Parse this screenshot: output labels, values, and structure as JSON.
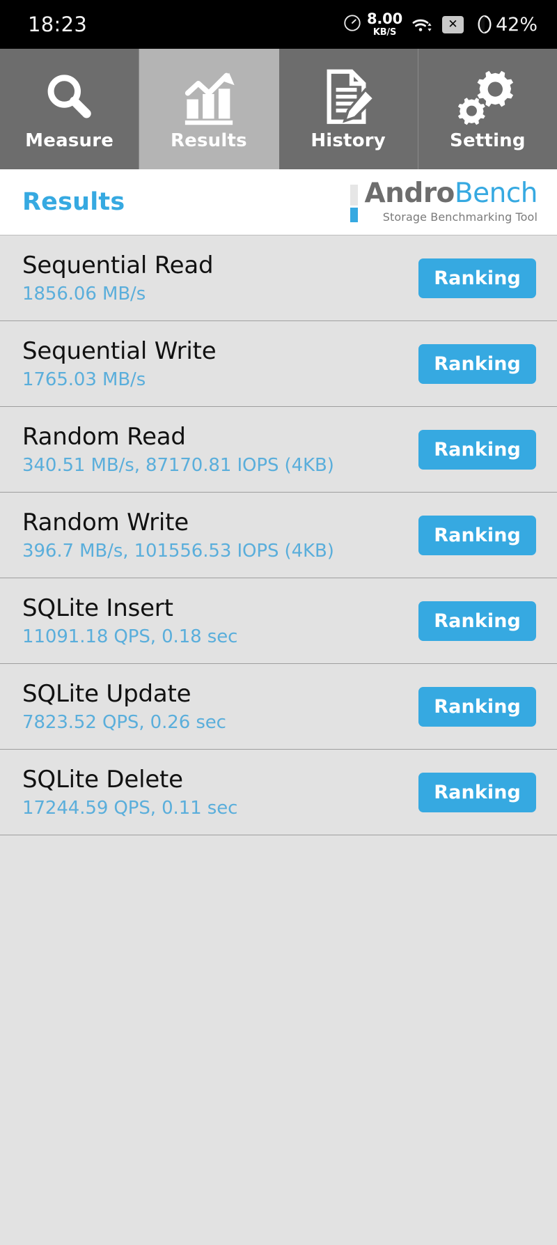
{
  "status_bar": {
    "time": "18:23",
    "network_speed_value": "8.00",
    "network_speed_unit": "KB/S",
    "battery_percent": "42%",
    "icons": [
      "speedometer-icon",
      "wifi-icon",
      "sim-no-signal-icon",
      "battery-icon"
    ]
  },
  "tabs": [
    {
      "label": "Measure",
      "icon": "magnifier-icon",
      "active": false
    },
    {
      "label": "Results",
      "icon": "bar-chart-arrow-icon",
      "active": true
    },
    {
      "label": "History",
      "icon": "document-pencil-icon",
      "active": false
    },
    {
      "label": "Setting",
      "icon": "gears-icon",
      "active": false
    }
  ],
  "header": {
    "page_title": "Results",
    "brand_first": "Andro",
    "brand_second": "Bench",
    "brand_subtitle": "Storage Benchmarking Tool"
  },
  "results": {
    "ranking_label": "Ranking",
    "rows": [
      {
        "title": "Sequential Read",
        "value": "1856.06 MB/s"
      },
      {
        "title": "Sequential Write",
        "value": "1765.03 MB/s"
      },
      {
        "title": "Random Read",
        "value": "340.51 MB/s, 87170.81 IOPS (4KB)"
      },
      {
        "title": "Random Write",
        "value": "396.7 MB/s, 101556.53 IOPS (4KB)"
      },
      {
        "title": "SQLite Insert",
        "value": "11091.18 QPS, 0.18 sec"
      },
      {
        "title": "SQLite Update",
        "value": "7823.52 QPS, 0.26 sec"
      },
      {
        "title": "SQLite Delete",
        "value": "17244.59 QPS, 0.11 sec"
      }
    ]
  },
  "colors": {
    "accent_blue": "#36a9e1",
    "value_blue": "#5aaedb",
    "tab_inactive": "#6d6d6d",
    "tab_active": "#b4b4b4",
    "list_bg": "#e2e2e2"
  }
}
